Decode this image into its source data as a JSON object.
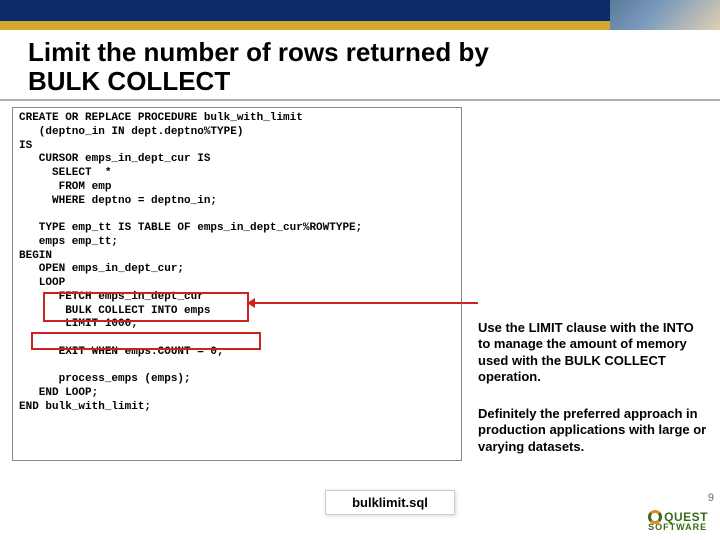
{
  "title_line1": "Limit the number of rows returned by",
  "title_line2": "BULK  COLLECT",
  "code": "CREATE OR REPLACE PROCEDURE bulk_with_limit\n   (deptno_in IN dept.deptno%TYPE)\nIS\n   CURSOR emps_in_dept_cur IS\n     SELECT  *\n      FROM emp\n     WHERE deptno = deptno_in;\n\n   TYPE emp_tt IS TABLE OF emps_in_dept_cur%ROWTYPE;\n   emps emp_tt;\nBEGIN\n   OPEN emps_in_dept_cur;\n   LOOP\n      FETCH emps_in_dept_cur\n       BULK COLLECT INTO emps\n       LIMIT 1000;\n\n      EXIT WHEN emps.COUNT = 0;\n\n      process_emps (emps);\n   END LOOP;\nEND bulk_with_limit;",
  "note1": "Use the LIMIT clause with the INTO to manage the amount of memory used with the BULK COLLECT operation.",
  "note2": "Definitely the preferred approach in production applications with large or varying datasets.",
  "file_label": "bulklimit.sql",
  "logo_brand": "QUEST",
  "logo_sub": "SOFTWARE",
  "page_number": "9"
}
